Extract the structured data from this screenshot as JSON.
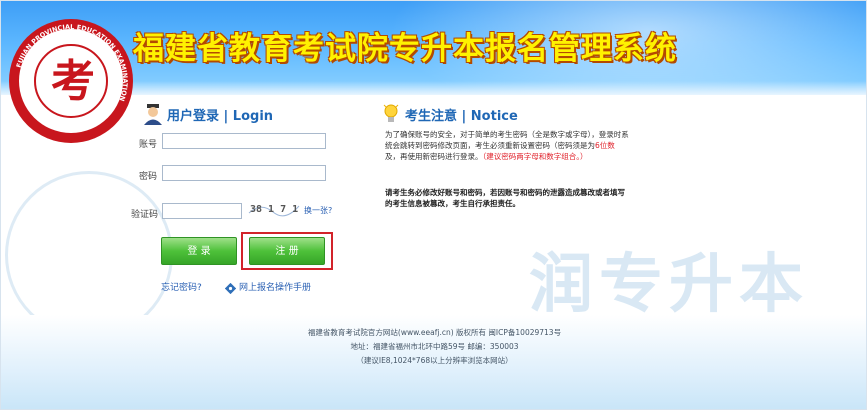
{
  "header": {
    "title": "福建省教育考试院专升本报名管理系统",
    "logo_text": "FUJIAN PROVINCIAL EDUCATION EXAMINATION"
  },
  "login": {
    "title": "用户登录 | Login",
    "account_label": "账号",
    "account_value": "",
    "password_label": "密码",
    "password_value": "",
    "captcha_label": "验证码",
    "captcha_value": "",
    "captcha_text": "38 1 7 1",
    "refresh_link": "换一张?",
    "login_button": "登 录",
    "reset_button": "注 册",
    "forgot_link": "忘记密码?",
    "manual_link": "网上报名操作手册"
  },
  "notice": {
    "title": "考生注意 | Notice",
    "line1": "为了确保账号的安全，对于简单的考生密码（全是数字或字母），登录时系",
    "line2": "统会跳转到密码修改页面，考生必须重新设置密码（密码须是为",
    "line2_red": "6位数",
    "line3": "及，再使用新密码进行登录。",
    "line3_red": "（建议密码两字母和数字组合。）",
    "bold_line1": "请考生务必修改好账号和密码，若因账号和密码的泄露造成篡改或者填写",
    "bold_line2": "的考生信息被篡改，考生自行承担责任。"
  },
  "watermark": {
    "text": "润专升本"
  },
  "footer": {
    "line1": "福建省教育考试院官方网站(www.eeafj.cn) 版权所有 闽ICP备10029713号",
    "line2": "地址：福建省福州市北环中路59号 邮编：350003",
    "line3": "（建议IE8,1024*768以上分辨率浏览本网站）"
  },
  "colors": {
    "header_blue": "#3e9ef6",
    "title_yellow": "#fff200",
    "accent_blue": "#1f67b5",
    "button_green": "#4ec13a",
    "highlight_red": "#d2232a"
  }
}
